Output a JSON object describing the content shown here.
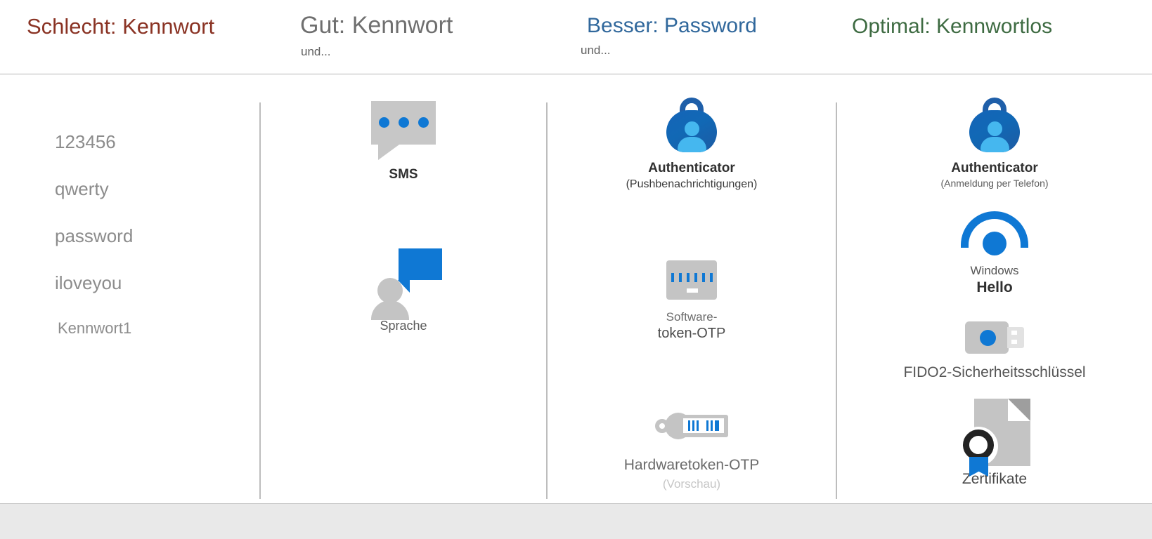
{
  "header": {
    "columns": [
      {
        "title": "Schlecht: Kennwort",
        "sub": "",
        "color": "#8a3324"
      },
      {
        "title": "Gut: Kennwort",
        "sub": "und...",
        "color": "#6f6f6f"
      },
      {
        "title": "Besser: Password",
        "sub": "und...",
        "color": "#31689c"
      },
      {
        "title": "Optimal: Kennwortlos",
        "sub": "",
        "color": "#3e6b42"
      }
    ]
  },
  "column1": {
    "passwords": [
      "123456",
      "qwerty",
      "password",
      "iloveyou",
      "Kennwort1"
    ]
  },
  "column2": {
    "items": [
      {
        "icon": "sms-bubble-icon",
        "label": "SMS"
      },
      {
        "icon": "voice-call-icon",
        "label": "Sprache"
      }
    ]
  },
  "column3": {
    "items": [
      {
        "icon": "microsoft-authenticator-icon",
        "label": "Authenticator",
        "sub": "(Pushbenachrichtigungen)"
      },
      {
        "icon": "software-token-icon",
        "label_line1": "Software-",
        "label_line2": "token-OTP"
      },
      {
        "icon": "hardware-token-icon",
        "label": "Hardwaretoken-OTP",
        "sub": "(Vorschau)"
      }
    ]
  },
  "column4": {
    "items": [
      {
        "icon": "microsoft-authenticator-icon",
        "label": "Authenticator",
        "sub": "(Anmeldung per Telefon)"
      },
      {
        "icon": "windows-hello-icon",
        "label_line1": "Windows",
        "label_line2": "Hello"
      },
      {
        "icon": "fido2-security-key-icon",
        "label": "FIDO2-Sicherheitsschlüssel"
      },
      {
        "icon": "certificate-icon",
        "label": "Zertifikate"
      }
    ]
  },
  "colors": {
    "bad": "#8a3324",
    "good": "#6f6f6f",
    "better": "#31689c",
    "best": "#3e6b42",
    "accent_blue": "#0f78d4",
    "icon_grey": "#c4c4c4"
  }
}
